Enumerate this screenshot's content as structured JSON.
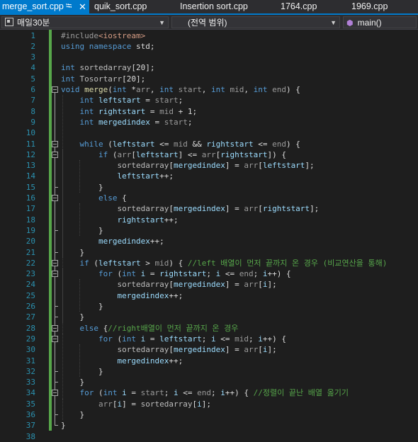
{
  "tabs": [
    {
      "label": "merge_sort.cpp",
      "active": true
    },
    {
      "label": "quik_sort.cpp",
      "active": false
    },
    {
      "label": "Insertion sort.cpp",
      "active": false
    },
    {
      "label": "1764.cpp",
      "active": false
    },
    {
      "label": "1969.cpp",
      "active": false
    }
  ],
  "navbar": {
    "project": "매일30분",
    "scope": "(전역 범위)",
    "member": "main()"
  },
  "editor": {
    "line_numbers": [
      "1",
      "2",
      "3",
      "4",
      "5",
      "6",
      "7",
      "8",
      "9",
      "10",
      "11",
      "12",
      "13",
      "14",
      "15",
      "16",
      "17",
      "18",
      "19",
      "20",
      "21",
      "22",
      "23",
      "24",
      "25",
      "26",
      "27",
      "28",
      "29",
      "30",
      "31",
      "32",
      "33",
      "34",
      "35",
      "36",
      "37",
      "38"
    ],
    "lines": [
      [
        {
          "t": "#include",
          "c": "pp"
        },
        {
          "t": "<iostream>",
          "c": "inc"
        }
      ],
      [
        {
          "t": "using",
          "c": "kw"
        },
        {
          "t": " "
        },
        {
          "t": "namespace",
          "c": "kw"
        },
        {
          "t": " std;"
        }
      ],
      [],
      [
        {
          "t": "int",
          "c": "kw"
        },
        {
          "t": " "
        },
        {
          "t": "sortedarray",
          "c": "gv"
        },
        {
          "t": "[20];"
        }
      ],
      [
        {
          "t": "int",
          "c": "kw"
        },
        {
          "t": " "
        },
        {
          "t": "Tosortarr",
          "c": "gv"
        },
        {
          "t": "[20];"
        }
      ],
      [
        {
          "t": "void",
          "c": "kw"
        },
        {
          "t": " "
        },
        {
          "t": "merge",
          "c": "fn"
        },
        {
          "t": "("
        },
        {
          "t": "int",
          "c": "kw"
        },
        {
          "t": " *"
        },
        {
          "t": "arr",
          "c": "par"
        },
        {
          "t": ", "
        },
        {
          "t": "int",
          "c": "kw"
        },
        {
          "t": " "
        },
        {
          "t": "start",
          "c": "par"
        },
        {
          "t": ", "
        },
        {
          "t": "int",
          "c": "kw"
        },
        {
          "t": " "
        },
        {
          "t": "mid",
          "c": "par"
        },
        {
          "t": ", "
        },
        {
          "t": "int",
          "c": "kw"
        },
        {
          "t": " "
        },
        {
          "t": "end",
          "c": "par"
        },
        {
          "t": ") {"
        }
      ],
      [
        {
          "t": "    "
        },
        {
          "t": "int",
          "c": "kw"
        },
        {
          "t": " "
        },
        {
          "t": "leftstart",
          "c": "loc"
        },
        {
          "t": " = "
        },
        {
          "t": "start",
          "c": "par"
        },
        {
          "t": ";"
        }
      ],
      [
        {
          "t": "    "
        },
        {
          "t": "int",
          "c": "kw"
        },
        {
          "t": " "
        },
        {
          "t": "rightstart",
          "c": "loc"
        },
        {
          "t": " = "
        },
        {
          "t": "mid",
          "c": "par"
        },
        {
          "t": " + 1;"
        }
      ],
      [
        {
          "t": "    "
        },
        {
          "t": "int",
          "c": "kw"
        },
        {
          "t": " "
        },
        {
          "t": "mergedindex",
          "c": "loc"
        },
        {
          "t": " = "
        },
        {
          "t": "start",
          "c": "par"
        },
        {
          "t": ";"
        }
      ],
      [],
      [
        {
          "t": "    "
        },
        {
          "t": "while",
          "c": "kw"
        },
        {
          "t": " ("
        },
        {
          "t": "leftstart",
          "c": "loc"
        },
        {
          "t": " <= "
        },
        {
          "t": "mid",
          "c": "par"
        },
        {
          "t": " && "
        },
        {
          "t": "rightstart",
          "c": "loc"
        },
        {
          "t": " <= "
        },
        {
          "t": "end",
          "c": "par"
        },
        {
          "t": ") {"
        }
      ],
      [
        {
          "t": "        "
        },
        {
          "t": "if",
          "c": "kw"
        },
        {
          "t": " ("
        },
        {
          "t": "arr",
          "c": "par"
        },
        {
          "t": "["
        },
        {
          "t": "leftstart",
          "c": "loc"
        },
        {
          "t": "] <= "
        },
        {
          "t": "arr",
          "c": "par"
        },
        {
          "t": "["
        },
        {
          "t": "rightstart",
          "c": "loc"
        },
        {
          "t": "]) {"
        }
      ],
      [
        {
          "t": "            "
        },
        {
          "t": "sortedarray",
          "c": "gv"
        },
        {
          "t": "["
        },
        {
          "t": "mergedindex",
          "c": "loc"
        },
        {
          "t": "] = "
        },
        {
          "t": "arr",
          "c": "par"
        },
        {
          "t": "["
        },
        {
          "t": "leftstart",
          "c": "loc"
        },
        {
          "t": "];"
        }
      ],
      [
        {
          "t": "            "
        },
        {
          "t": "leftstart",
          "c": "loc"
        },
        {
          "t": "++;"
        }
      ],
      [
        {
          "t": "        }"
        }
      ],
      [
        {
          "t": "        "
        },
        {
          "t": "else",
          "c": "kw"
        },
        {
          "t": " {"
        }
      ],
      [
        {
          "t": "            "
        },
        {
          "t": "sortedarray",
          "c": "gv"
        },
        {
          "t": "["
        },
        {
          "t": "mergedindex",
          "c": "loc"
        },
        {
          "t": "] = "
        },
        {
          "t": "arr",
          "c": "par"
        },
        {
          "t": "["
        },
        {
          "t": "rightstart",
          "c": "loc"
        },
        {
          "t": "];"
        }
      ],
      [
        {
          "t": "            "
        },
        {
          "t": "rightstart",
          "c": "loc"
        },
        {
          "t": "++;"
        }
      ],
      [
        {
          "t": "        }"
        }
      ],
      [
        {
          "t": "        "
        },
        {
          "t": "mergedindex",
          "c": "loc"
        },
        {
          "t": "++;"
        }
      ],
      [
        {
          "t": "    }"
        }
      ],
      [
        {
          "t": "    "
        },
        {
          "t": "if",
          "c": "kw"
        },
        {
          "t": " ("
        },
        {
          "t": "leftstart",
          "c": "loc"
        },
        {
          "t": " > "
        },
        {
          "t": "mid",
          "c": "par"
        },
        {
          "t": ") { "
        },
        {
          "t": "//left 배열이 먼저 끝까지 온 경우 (비교연산을 통해)",
          "c": "cm"
        }
      ],
      [
        {
          "t": "        "
        },
        {
          "t": "for",
          "c": "kw"
        },
        {
          "t": " ("
        },
        {
          "t": "int",
          "c": "kw"
        },
        {
          "t": " "
        },
        {
          "t": "i",
          "c": "loc"
        },
        {
          "t": " = "
        },
        {
          "t": "rightstart",
          "c": "loc"
        },
        {
          "t": "; "
        },
        {
          "t": "i",
          "c": "loc"
        },
        {
          "t": " <= "
        },
        {
          "t": "end",
          "c": "par"
        },
        {
          "t": "; "
        },
        {
          "t": "i",
          "c": "loc"
        },
        {
          "t": "++) {"
        }
      ],
      [
        {
          "t": "            "
        },
        {
          "t": "sortedarray",
          "c": "gv"
        },
        {
          "t": "["
        },
        {
          "t": "mergedindex",
          "c": "loc"
        },
        {
          "t": "] = "
        },
        {
          "t": "arr",
          "c": "par"
        },
        {
          "t": "["
        },
        {
          "t": "i",
          "c": "loc"
        },
        {
          "t": "];"
        }
      ],
      [
        {
          "t": "            "
        },
        {
          "t": "mergedindex",
          "c": "loc"
        },
        {
          "t": "++;"
        }
      ],
      [
        {
          "t": "        }"
        }
      ],
      [
        {
          "t": "    }"
        }
      ],
      [
        {
          "t": "    "
        },
        {
          "t": "else",
          "c": "kw"
        },
        {
          "t": " {"
        },
        {
          "t": "//right배열이 먼저 끝까지 온 경우",
          "c": "cm"
        }
      ],
      [
        {
          "t": "        "
        },
        {
          "t": "for",
          "c": "kw"
        },
        {
          "t": " ("
        },
        {
          "t": "int",
          "c": "kw"
        },
        {
          "t": " "
        },
        {
          "t": "i",
          "c": "loc"
        },
        {
          "t": " = "
        },
        {
          "t": "leftstart",
          "c": "loc"
        },
        {
          "t": "; "
        },
        {
          "t": "i",
          "c": "loc"
        },
        {
          "t": " <= "
        },
        {
          "t": "mid",
          "c": "par"
        },
        {
          "t": "; "
        },
        {
          "t": "i",
          "c": "loc"
        },
        {
          "t": "++) {"
        }
      ],
      [
        {
          "t": "            "
        },
        {
          "t": "sortedarray",
          "c": "gv"
        },
        {
          "t": "["
        },
        {
          "t": "mergedindex",
          "c": "loc"
        },
        {
          "t": "] = "
        },
        {
          "t": "arr",
          "c": "par"
        },
        {
          "t": "["
        },
        {
          "t": "i",
          "c": "loc"
        },
        {
          "t": "];"
        }
      ],
      [
        {
          "t": "            "
        },
        {
          "t": "mergedindex",
          "c": "loc"
        },
        {
          "t": "++;"
        }
      ],
      [
        {
          "t": "        }"
        }
      ],
      [
        {
          "t": "    }"
        }
      ],
      [
        {
          "t": "    "
        },
        {
          "t": "for",
          "c": "kw"
        },
        {
          "t": " ("
        },
        {
          "t": "int",
          "c": "kw"
        },
        {
          "t": " "
        },
        {
          "t": "i",
          "c": "loc"
        },
        {
          "t": " = "
        },
        {
          "t": "start",
          "c": "par"
        },
        {
          "t": "; "
        },
        {
          "t": "i",
          "c": "loc"
        },
        {
          "t": " <= "
        },
        {
          "t": "end",
          "c": "par"
        },
        {
          "t": "; "
        },
        {
          "t": "i",
          "c": "loc"
        },
        {
          "t": "++) { "
        },
        {
          "t": "//정렬이 끝난 배열 옮기기",
          "c": "cm"
        }
      ],
      [
        {
          "t": "        "
        },
        {
          "t": "arr",
          "c": "par"
        },
        {
          "t": "["
        },
        {
          "t": "i",
          "c": "loc"
        },
        {
          "t": "] = "
        },
        {
          "t": "sortedarray",
          "c": "gv"
        },
        {
          "t": "["
        },
        {
          "t": "i",
          "c": "loc"
        },
        {
          "t": "];"
        }
      ],
      [
        {
          "t": "    }"
        }
      ],
      [
        {
          "t": "}"
        }
      ],
      []
    ]
  }
}
